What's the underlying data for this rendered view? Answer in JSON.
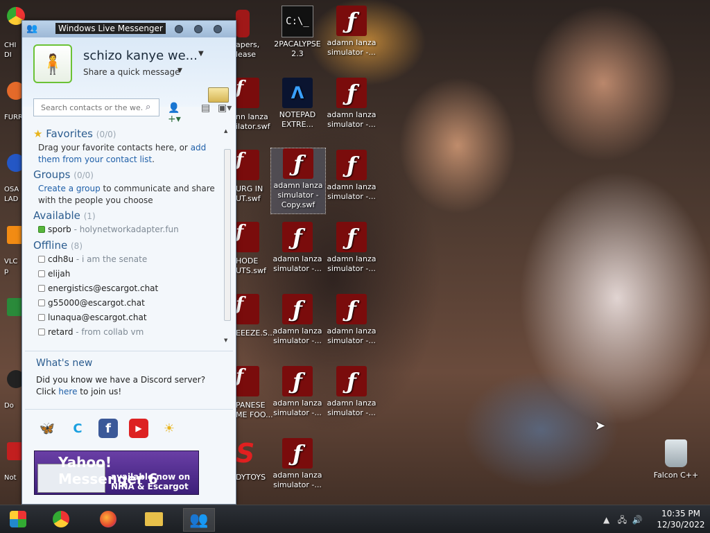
{
  "window": {
    "title": "Windows Live Messenger",
    "display_name": "schizo kanye we...",
    "personal_message": "Share a quick message",
    "search_placeholder": "Search contacts or the we..."
  },
  "groups": {
    "favorites": {
      "title": "Favorites",
      "count": "(0/0)",
      "text_before": "Drag your favorite contacts here, or ",
      "link": "add them from your contact list",
      "text_after": "."
    },
    "groups": {
      "title": "Groups",
      "count": "(0/0)",
      "link": "Create a group",
      "text_after": " to communicate and share with the people you choose"
    },
    "available": {
      "title": "Available",
      "count": "(1)",
      "contacts": [
        {
          "name": "sporb",
          "message": "holynetworkadapter.fun"
        }
      ]
    },
    "offline": {
      "title": "Offline",
      "count": "(8)",
      "contacts": [
        {
          "name": "cdh8u",
          "message": "i am the senate"
        },
        {
          "name": "elijah",
          "message": ""
        },
        {
          "name": "energistics@escargot.chat",
          "message": ""
        },
        {
          "name": "g55000@escargot.chat",
          "message": ""
        },
        {
          "name": "lunaqua@escargot.chat",
          "message": ""
        },
        {
          "name": "retard",
          "message": "from collab vm"
        }
      ]
    }
  },
  "whats_new": {
    "title": "What's new",
    "text_before": "Did you know we have a Discord server? Click ",
    "link": "here",
    "text_after": " to join us!"
  },
  "ad": {
    "line1": "Yahoo! Messenger 6",
    "line2": "available now on",
    "line3": "NINA & Escargot"
  },
  "desktop": {
    "icons": [
      {
        "label1": "2PACALYPSE",
        "label2": "2.3"
      },
      {
        "label1": "adamn lanza",
        "label2": "simulator -..."
      },
      {
        "label1": "NOTEPAD",
        "label2": "EXTRE..."
      },
      {
        "label1": "adamn lanza",
        "label2": "simulator -..."
      },
      {
        "label1": "adamn lanza",
        "label2": "simulator -",
        "label3": "Copy.swf"
      },
      {
        "label1": "adamn lanza",
        "label2": "simulator -..."
      },
      {
        "label1": "adamn lanza",
        "label2": "simulator -..."
      },
      {
        "label1": "adamn lanza",
        "label2": "simulator -..."
      },
      {
        "label1": "adamn lanza",
        "label2": "simulator -..."
      },
      {
        "label1": "adamn lanza",
        "label2": "simulator -..."
      },
      {
        "label1": "adamn lanza",
        "label2": "simulator -..."
      },
      {
        "label1": "adamn lanza",
        "label2": "simulator -..."
      },
      {
        "label1": "adamn lanza",
        "label2": "simulator -..."
      },
      {
        "label1": "Falcon C++",
        "label2": ""
      }
    ],
    "partial_labels": [
      "apers,",
      "lease",
      "nn lanza",
      "ilator.swf",
      "URG IN",
      "UT.swf",
      "HODE",
      "UTS.swf",
      "EEEZE.S...",
      "PANESE",
      "ME FOO...",
      "DYTOYS",
      "CHI",
      "DI",
      "FURR",
      "OSA",
      "LAD",
      "VLC",
      "p",
      "Do",
      "Not",
      "D",
      "C"
    ]
  },
  "clock": {
    "time": "10:35 PM",
    "date": "12/30/2022"
  }
}
